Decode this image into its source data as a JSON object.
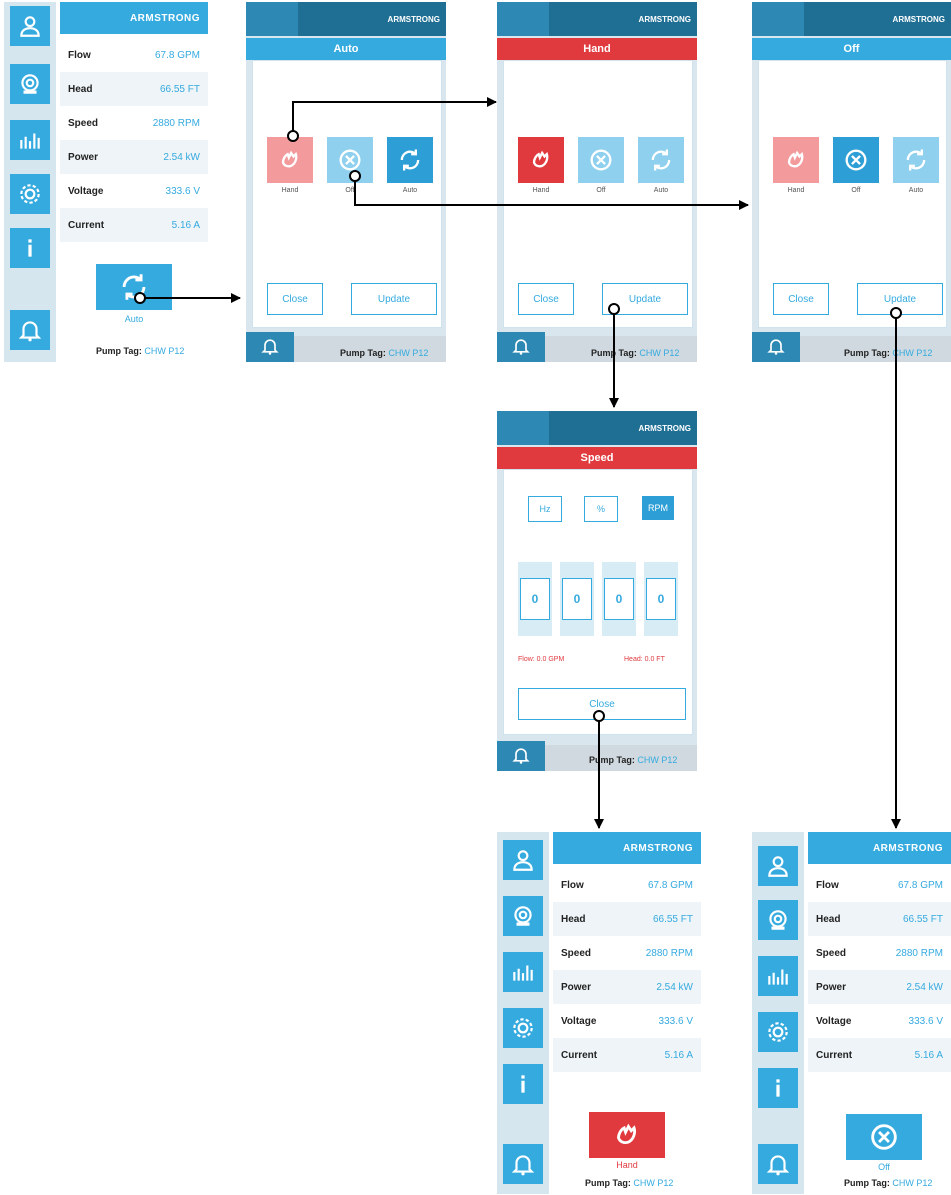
{
  "brand": "ARMSTRONG",
  "metrics": [
    {
      "label": "Flow",
      "value": "67.8 GPM"
    },
    {
      "label": "Head",
      "value": "66.55 FT"
    },
    {
      "label": "Speed",
      "value": "2880 RPM"
    },
    {
      "label": "Power",
      "value": "2.54 kW"
    },
    {
      "label": "Voltage",
      "value": "333.6 V"
    },
    {
      "label": "Current",
      "value": "5.16 A"
    }
  ],
  "pump_tag_label": "Pump Tag:",
  "pump_tag_value": "CHW P12",
  "modes": {
    "auto": "Auto",
    "hand": "Hand",
    "off": "Off"
  },
  "buttons": {
    "close": "Close",
    "update": "Update"
  },
  "speed_dialog": {
    "title": "Speed",
    "units": [
      "Hz",
      "%",
      "RPM"
    ],
    "digits": [
      "0",
      "0",
      "0",
      "0"
    ],
    "flow_warning": "Flow: 0.0 GPM",
    "head_warning": "Head: 0.0 FT"
  },
  "colors": {
    "primary": "#35aadf",
    "hand_red": "#e03a3e",
    "dark": "#1f6f94"
  },
  "icons": [
    "user-icon",
    "pump-icon",
    "chart-icon",
    "gear-icon",
    "info-icon",
    "bell-icon",
    "refresh-icon",
    "hand-icon",
    "off-icon"
  ]
}
